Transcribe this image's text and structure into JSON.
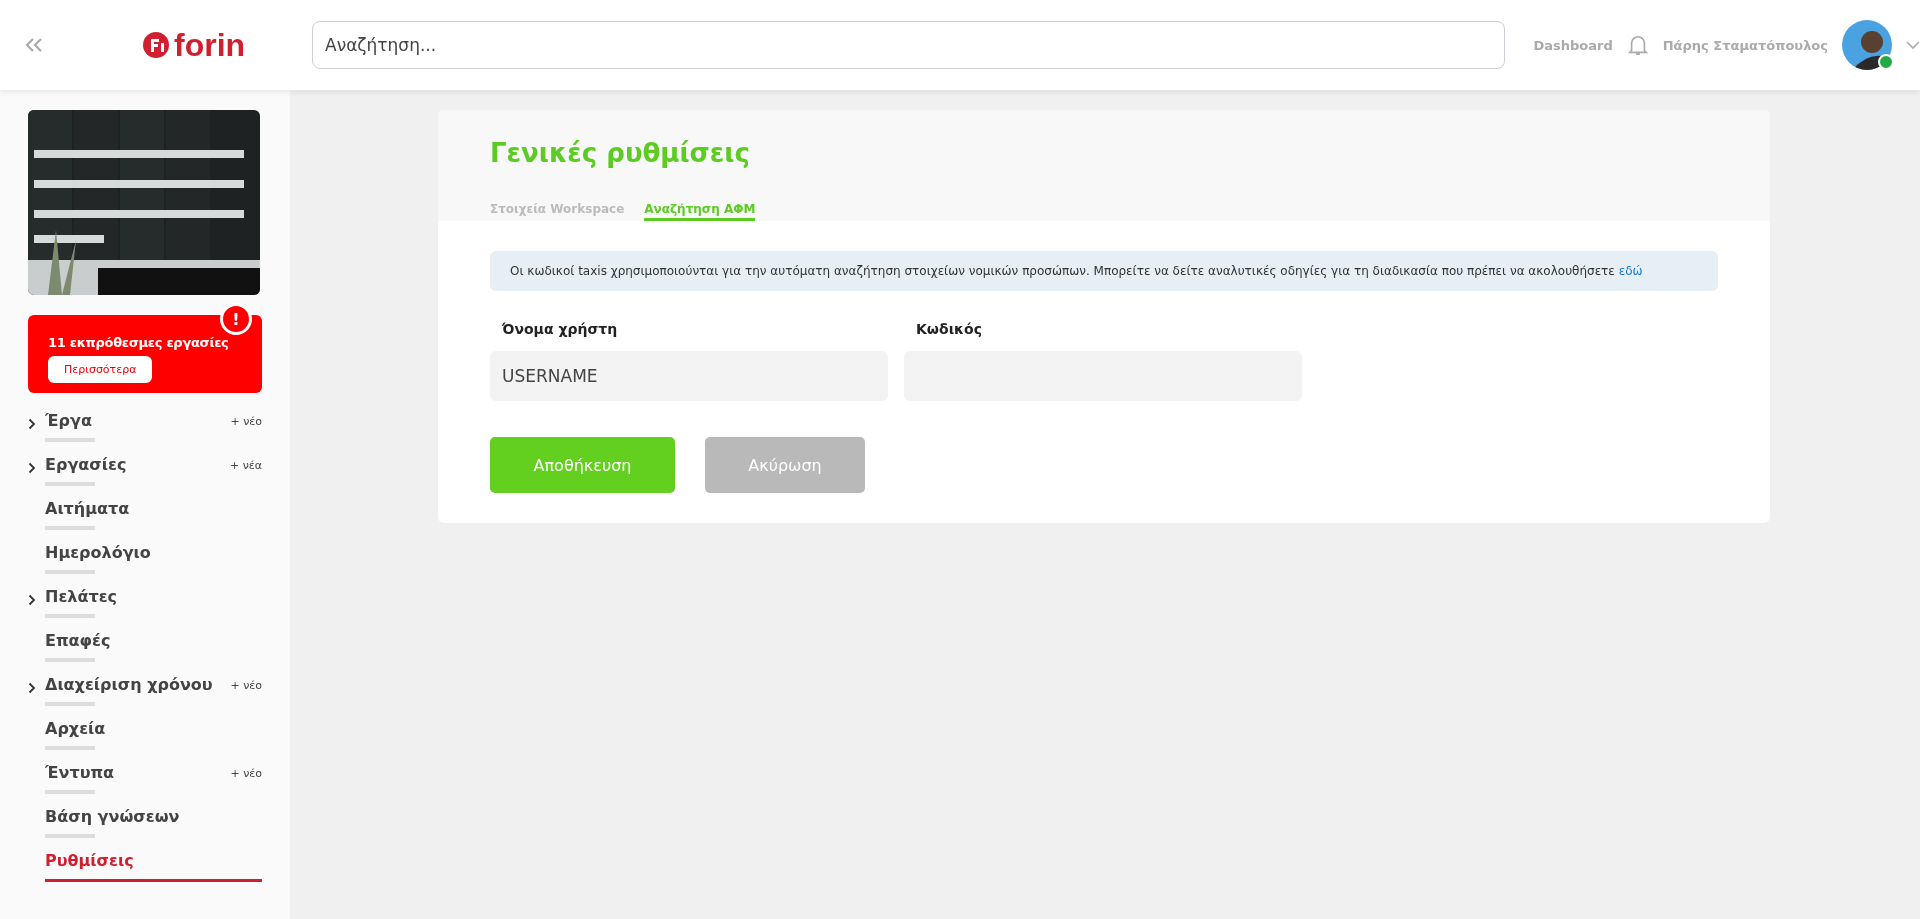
{
  "header": {
    "logo_text": "forin",
    "search": {
      "placeholder": "Αναζήτηση..."
    },
    "dashboard_link": "Dashboard",
    "user_name": "Πάρης Σταματόπουλος",
    "user_online": true
  },
  "sidebar": {
    "alert": {
      "text": "11 εκπρόθεσμες εργασίες",
      "button": "Περισσότερα",
      "badge": "!"
    },
    "items": [
      {
        "label": "Έργα",
        "expandable": true,
        "new_label": "+ νέο",
        "selected": false
      },
      {
        "label": "Εργασίες",
        "expandable": true,
        "new_label": "+ νέα",
        "selected": false
      },
      {
        "label": "Αιτήματα",
        "expandable": false,
        "selected": false
      },
      {
        "label": "Ημερολόγιο",
        "expandable": false,
        "selected": false
      },
      {
        "label": "Πελάτες",
        "expandable": true,
        "selected": false
      },
      {
        "label": "Επαφές",
        "expandable": false,
        "selected": false
      },
      {
        "label": "Διαχείριση χρόνου",
        "expandable": true,
        "new_label": "+ νέο",
        "selected": false
      },
      {
        "label": "Αρχεία",
        "expandable": false,
        "selected": false
      },
      {
        "label": "Έντυπα",
        "expandable": false,
        "new_label": "+ νέο",
        "selected": false
      },
      {
        "label": "Βάση γνώσεων",
        "expandable": false,
        "selected": false
      },
      {
        "label": "Ρυθμίσεις",
        "expandable": false,
        "selected": true
      }
    ]
  },
  "settings": {
    "title": "Γενικές ρυθμίσεις",
    "tabs": [
      {
        "label": "Στοιχεία Workspace",
        "selected": false
      },
      {
        "label": "Αναζήτηση ΑΦΜ",
        "selected": true
      }
    ],
    "info": {
      "text": "Οι κωδικοί taxis χρησιμοποιούνται για την αυτόματη αναζήτηση στοιχείων νομικών προσώπων. Μπορείτε να δείτε αναλυτικές οδηγίες για τη διαδικασία που πρέπει να ακολουθήσετε",
      "link": "εδώ"
    },
    "fields": [
      {
        "label": "Όνομα χρήστη",
        "value": "USERNAME"
      },
      {
        "label": "Κωδικός"
      }
    ],
    "buttons": [
      {
        "label": "Αποθήκευση",
        "kind": "primary"
      },
      {
        "label": "Ακύρωση",
        "kind": "secondary"
      }
    ]
  }
}
